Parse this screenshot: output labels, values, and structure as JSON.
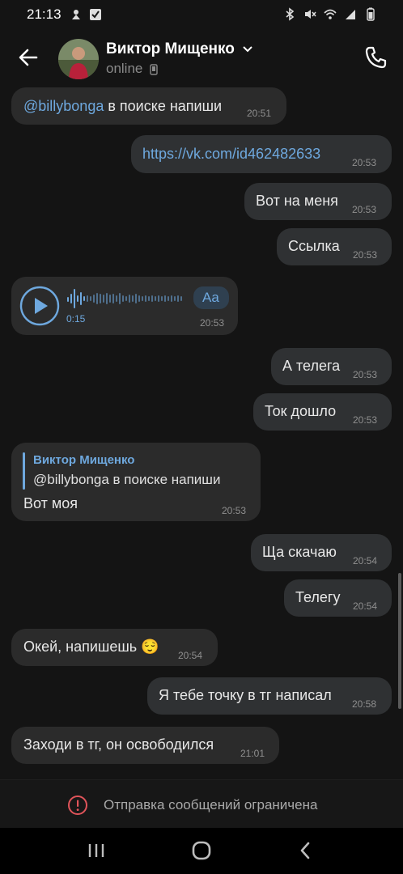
{
  "status_bar": {
    "time": "21:13"
  },
  "header": {
    "contact_name": "Виктор Мищенко",
    "status": "online"
  },
  "messages": [
    {
      "direction": "in",
      "text_mention": "@billybonga",
      "text": "в поиске напиши",
      "time": "20:51"
    },
    {
      "direction": "out",
      "text": "https://vk.com/id462482633",
      "time": "20:53",
      "is_link": true
    },
    {
      "direction": "out",
      "text": "Вот на меня",
      "time": "20:53"
    },
    {
      "direction": "out",
      "text": "Ссылка",
      "time": "20:53"
    },
    {
      "direction": "in",
      "type": "voice",
      "duration": "0:15",
      "transcribe_label": "Aa",
      "time": "20:53"
    },
    {
      "direction": "out",
      "text": "А телега",
      "time": "20:53"
    },
    {
      "direction": "out",
      "text": "Ток дошло",
      "time": "20:53"
    },
    {
      "direction": "in",
      "reply_author": "Виктор Мищенко",
      "reply_text": "@billybonga в поиске напиши",
      "text": "Вот моя",
      "time": "20:53"
    },
    {
      "direction": "out",
      "text": "Ща скачаю",
      "time": "20:54"
    },
    {
      "direction": "out",
      "text": "Телегу",
      "time": "20:54"
    },
    {
      "direction": "in",
      "text": "Окей, напишешь",
      "emoji": "😌",
      "time": "20:54"
    },
    {
      "direction": "out",
      "text": "Я тебе точку в тг написал",
      "time": "20:58"
    },
    {
      "direction": "in",
      "text": "Заходи в тг, он освободился",
      "time": "21:01"
    }
  ],
  "footer": {
    "restricted_text": "Отправка сообщений ограничена"
  },
  "colors": {
    "accent": "#6ea8de",
    "bubble_in": "#2b2b2b",
    "bubble_out": "#2f3133",
    "background": "#141414",
    "warning": "#e0545a"
  }
}
